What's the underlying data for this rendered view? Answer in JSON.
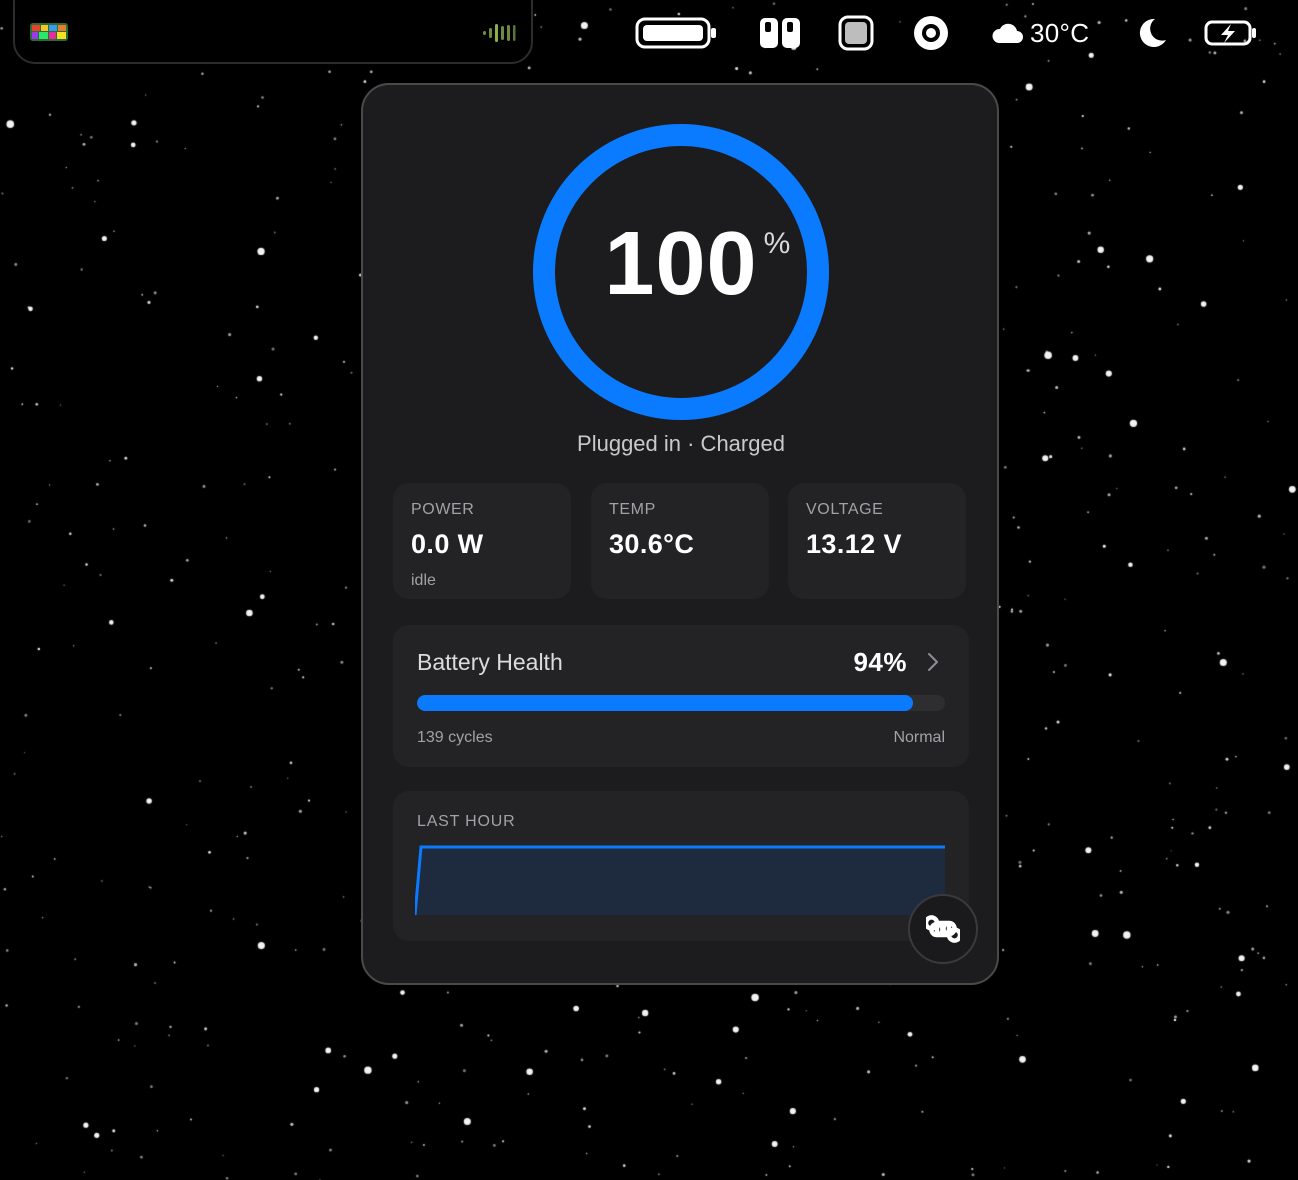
{
  "menubar": {
    "left_app_icon": "colorful-app-icon",
    "audio_icon": "audio-level-icon",
    "weather": {
      "icon": "cloud-icon",
      "temperature": "30°C"
    },
    "icons": [
      "battery-icon",
      "panel-layout-icon",
      "square-app-icon",
      "record-icon",
      "cloud-icon",
      "moon-icon",
      "charging-battery-icon"
    ]
  },
  "battery": {
    "percent": "100",
    "percent_sign": "%",
    "level": 1.0,
    "status": "Plugged in · Charged",
    "accent_color": "#0a7aff"
  },
  "stats": [
    {
      "label": "POWER",
      "value": "0.0 W",
      "sub": "idle"
    },
    {
      "label": "TEMP",
      "value": "30.6°C",
      "sub": ""
    },
    {
      "label": "VOLTAGE",
      "value": "13.12 V",
      "sub": ""
    }
  ],
  "health": {
    "title": "Battery Health",
    "value": "94%",
    "fraction": 0.94,
    "cycles": "139 cycles",
    "state": "Normal"
  },
  "last_hour": {
    "label": "LAST HOUR",
    "percent_series": [
      0,
      100,
      100,
      100,
      100,
      100,
      100,
      100,
      100,
      100,
      100,
      100,
      100
    ]
  },
  "fab": {
    "icon": "command-icon"
  }
}
